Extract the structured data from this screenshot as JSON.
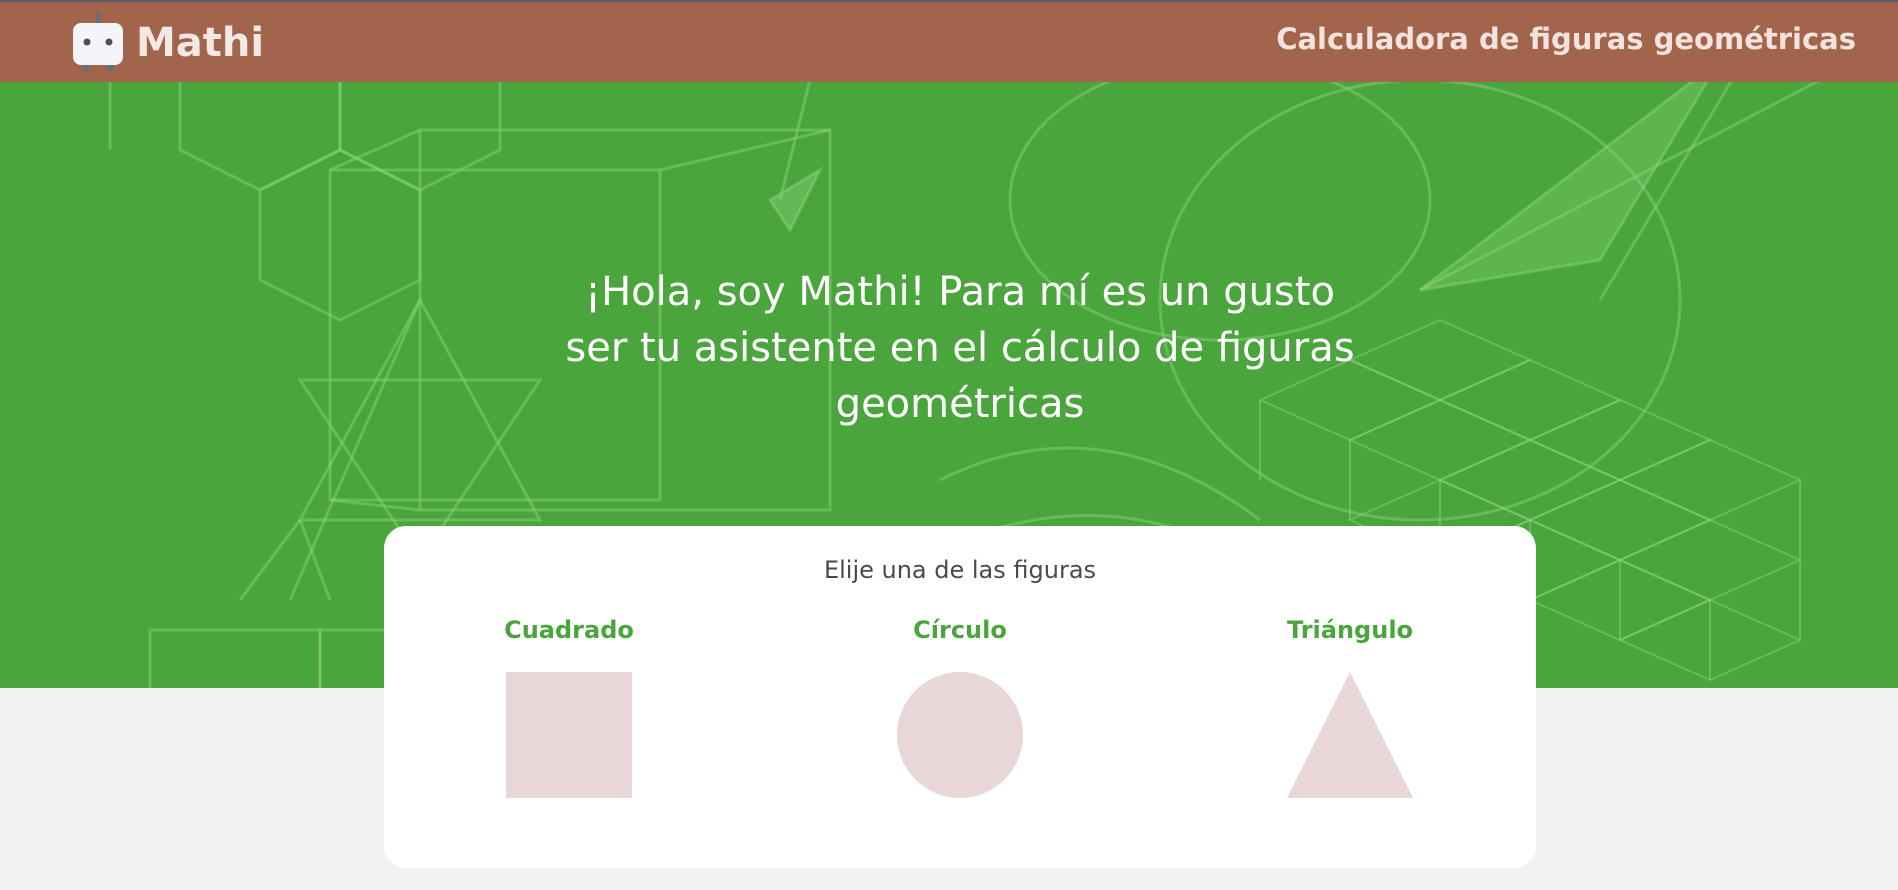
{
  "header": {
    "brand_name": "Mathi",
    "title": "Calculadora de figuras geométricas",
    "logo_icon": "robot-icon"
  },
  "hero": {
    "message": "¡Hola, soy Mathi! Para mí es un gusto ser tu asistente en el cálculo de figuras geométricas"
  },
  "card": {
    "subtitle": "Elije una de las figuras",
    "shapes": [
      {
        "label": "Cuadrado",
        "icon": "square-icon"
      },
      {
        "label": "Círculo",
        "icon": "circle-icon"
      },
      {
        "label": "Triángulo",
        "icon": "triangle-icon"
      }
    ]
  },
  "colors": {
    "header_bg": "#a2644b",
    "hero_bg": "#4aa63c",
    "accent_green": "#4aa63c",
    "shape_fill": "#e9d6d8",
    "page_bg": "#f3f1f1"
  }
}
